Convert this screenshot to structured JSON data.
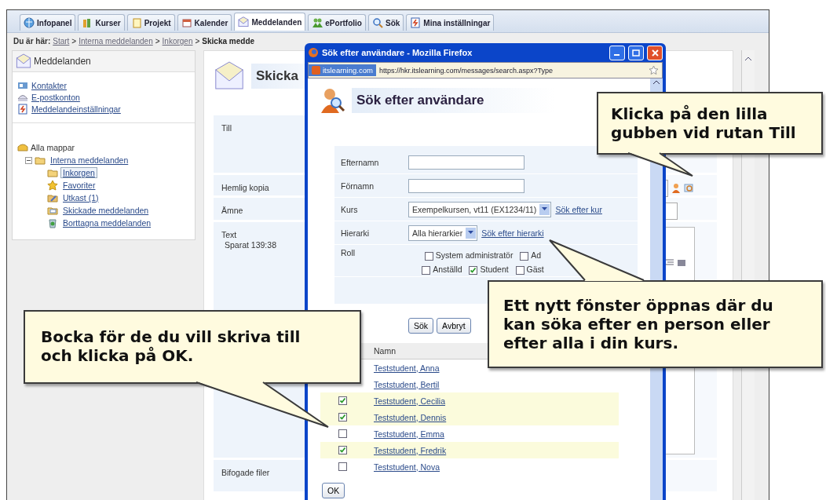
{
  "tabs": [
    {
      "label": "Infopanel",
      "selected": false
    },
    {
      "label": "Kurser",
      "selected": false
    },
    {
      "label": "Projekt",
      "selected": false
    },
    {
      "label": "Kalender",
      "selected": false
    },
    {
      "label": "Meddelanden",
      "selected": true
    },
    {
      "label": "ePortfolio",
      "selected": false
    },
    {
      "label": "Sök",
      "selected": false
    },
    {
      "label": "Mina inställningar",
      "selected": false
    }
  ],
  "breadcrumb": {
    "prefix": "Du är här:",
    "items": [
      {
        "label": "Start",
        "kind": "link"
      },
      {
        "label": ">",
        "kind": "separator"
      },
      {
        "label": "Interna meddelanden",
        "kind": "link"
      },
      {
        "label": ">",
        "kind": "separator"
      },
      {
        "label": "Inkorgen",
        "kind": "link"
      },
      {
        "label": ">",
        "kind": "separator"
      },
      {
        "label": "Skicka medde",
        "kind": "current"
      }
    ]
  },
  "sidebar": {
    "title": "Meddelanden",
    "links": [
      {
        "label": "Kontakter"
      },
      {
        "label": "E-postkonton"
      },
      {
        "label": "Meddelandeinställningar"
      }
    ],
    "tree": {
      "label": "Alla mappar",
      "children": [
        {
          "label": "Interna meddelanden",
          "expanded": true,
          "children": [
            {
              "label": "Inkorgen",
              "selected": true
            },
            {
              "label": "Favoriter",
              "selected": false
            },
            {
              "label": "Utkast (1)",
              "selected": false
            },
            {
              "label": "Skickade meddelanden",
              "selected": false
            },
            {
              "label": "Borttagna meddelanden",
              "selected": false
            }
          ]
        }
      ]
    }
  },
  "compose": {
    "title": "Skicka",
    "fields": [
      {
        "label": "Till",
        "kind": "recipients"
      },
      {
        "label": "Hemlig kopia",
        "kind": "picker"
      },
      {
        "label": "Ämne",
        "kind": "input"
      },
      {
        "label": "Text",
        "note": "Sparat 139:38",
        "kind": "editor"
      },
      {
        "label": "Bifogade filer",
        "kind": "files"
      }
    ]
  },
  "popup": {
    "title": "Sök efter användare - Mozilla Firefox",
    "site": "itslearning.com",
    "url": "https://hkr.itslearning.com/messages/search.aspx?Type",
    "heading": "Sök efter användare",
    "fields": [
      {
        "label": "Efternamn",
        "kind": "text"
      },
      {
        "label": "Förnamn",
        "kind": "text"
      },
      {
        "label": "Kurs",
        "kind": "select",
        "value": "Exempelkursen, vt11 (EX1234/11)",
        "link": "Sök efter kur"
      },
      {
        "label": "Hierarki",
        "kind": "select",
        "value": "Alla hierarkier",
        "link": "Sök efter hierarki"
      },
      {
        "label": "Roll",
        "kind": "roles",
        "roles": [
          {
            "label": "System administratör",
            "checked": false
          },
          {
            "label": "Ad",
            "checked": false
          },
          {
            "label": "Anställd",
            "checked": false
          },
          {
            "label": "Student",
            "checked": true
          },
          {
            "label": "Gäst",
            "checked": false
          }
        ]
      }
    ],
    "buttons": [
      "Sök",
      "Avbryt"
    ],
    "column": "Namn",
    "people": [
      {
        "name": "Teststudent, Anna"
      },
      {
        "name": "Teststudent, Bertil"
      },
      {
        "name": "Teststudent, Cecilia",
        "checked": true
      },
      {
        "name": "Teststudent, Dennis",
        "checked": true
      },
      {
        "name": "Teststudent, Emma",
        "checked": false
      },
      {
        "name": "Teststudent, Fredrik",
        "checked": true
      },
      {
        "name": "Teststudent, Nova",
        "checked": false
      }
    ],
    "ok": "OK"
  },
  "callouts": [
    {
      "text": "Klicka på den lilla gubben vid rutan Till"
    },
    {
      "text": "Ett nytt fönster öppnas där du kan söka efter en person eller efter alla i din kurs."
    },
    {
      "text": "Bocka för de du vill skriva till och klicka på OK."
    }
  ]
}
